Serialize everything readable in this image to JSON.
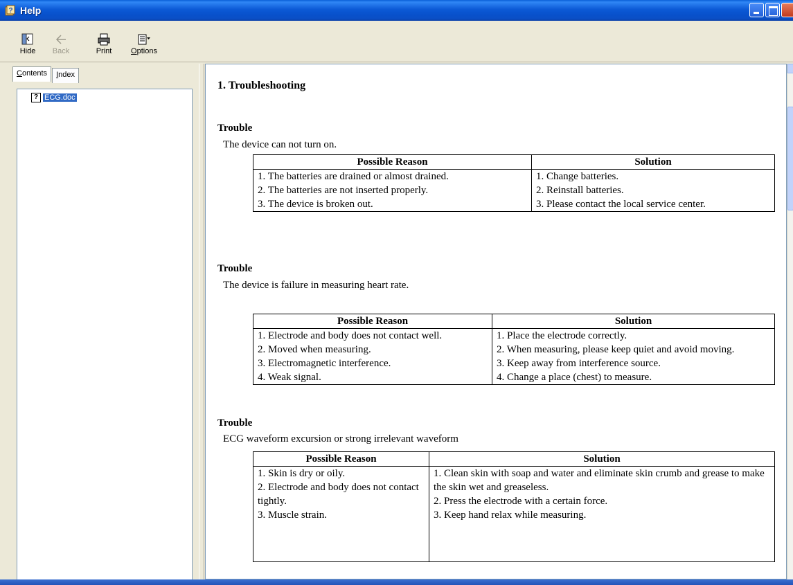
{
  "window": {
    "title": "Help",
    "icon": "help-book-icon"
  },
  "toolbar": {
    "hide_label": "Hide",
    "back_label": "Back",
    "print_label": "Print",
    "options_label_prefix": "",
    "options_label_mnemonic": "O",
    "options_label_rest": "ptions",
    "hide_icon": "hide-pane-icon",
    "back_icon": "back-arrow-icon",
    "print_icon": "printer-icon",
    "options_icon": "options-icon"
  },
  "navigation": {
    "tabs": [
      {
        "mnemonic": "C",
        "rest": "ontents",
        "active": true
      },
      {
        "mnemonic": "I",
        "rest": "ndex",
        "active": false
      }
    ],
    "tree_items": [
      {
        "label": "ECG.doc",
        "icon": "help-topic-icon",
        "selected": true
      }
    ]
  },
  "document": {
    "heading": "1.   Troubleshooting",
    "sections": [
      {
        "head": "Trouble",
        "description": "The device can not turn on.",
        "columns": [
          "Possible Reason",
          "Solution"
        ],
        "reasons": [
          "1. The batteries are drained or almost drained.",
          "2. The batteries are not inserted properly.",
          "3. The device is broken out."
        ],
        "solutions": [
          "1. Change batteries.",
          "2. Reinstall batteries.",
          "3. Please contact the local service center."
        ]
      },
      {
        "head": "Trouble",
        "description": "The device is failure in measuring heart rate.",
        "columns": [
          "Possible Reason",
          "Solution"
        ],
        "reasons": [
          "1. Electrode and body does not contact well.",
          "2. Moved when measuring.",
          "3. Electromagnetic interference.",
          "4. Weak signal."
        ],
        "solutions": [
          "1. Place the electrode correctly.",
          "2. When measuring, please keep quiet and avoid moving.",
          "3. Keep away from interference source.",
          "4. Change a place (chest) to measure."
        ]
      },
      {
        "head": "Trouble",
        "description": "ECG waveform excursion or strong irrelevant waveform",
        "columns": [
          "Possible Reason",
          "Solution"
        ],
        "reasons": [
          "1. Skin is dry or oily.",
          "2. Electrode and body does not contact tightly.",
          "3. Muscle strain."
        ],
        "solutions": [
          "1. Clean skin with soap and water and eliminate skin crumb and grease to make the skin wet and greaseless.",
          "2. Press the electrode with a certain force.",
          "3. Keep hand relax while measuring."
        ]
      }
    ]
  }
}
